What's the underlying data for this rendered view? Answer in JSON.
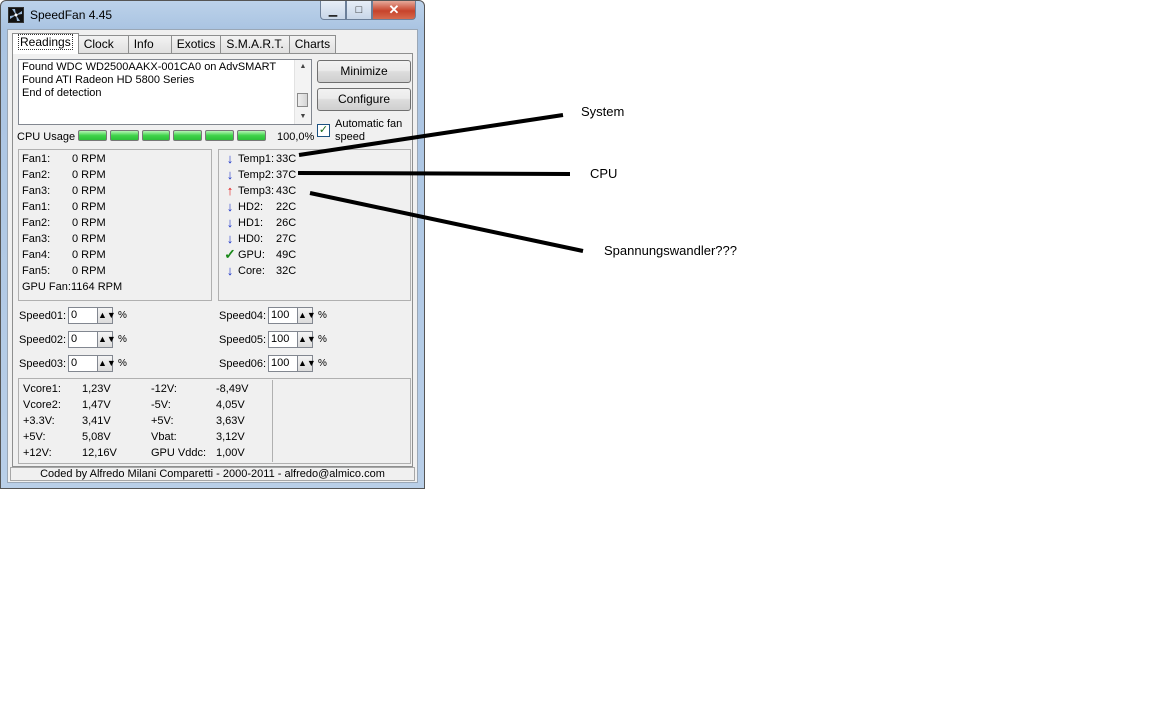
{
  "window": {
    "title": "SpeedFan 4.45",
    "caption": {
      "min": "▁",
      "max": "□",
      "close": "✕"
    }
  },
  "tabs": [
    {
      "label": "Readings",
      "active": true
    },
    {
      "label": "Clock"
    },
    {
      "label": "Info"
    },
    {
      "label": "Exotics"
    },
    {
      "label": "S.M.A.R.T."
    },
    {
      "label": "Charts"
    }
  ],
  "log": {
    "lines": [
      "Found WDC WD2500AAKX-001CA0 on AdvSMART",
      "Found ATI Radeon HD 5800 Series",
      "End of detection"
    ],
    "scroll_up": "▲",
    "scroll_down": "▼"
  },
  "buttons": {
    "minimize": "Minimize",
    "configure": "Configure"
  },
  "cpu": {
    "label": "CPU Usage",
    "percent": "100,0%",
    "fill": 1.0
  },
  "auto_fan": {
    "label": "Automatic fan speed",
    "checked": true,
    "mark": "✓"
  },
  "fans": [
    {
      "label": "Fan1:",
      "value": "0 RPM"
    },
    {
      "label": "Fan2:",
      "value": "0 RPM"
    },
    {
      "label": "Fan3:",
      "value": "0 RPM"
    },
    {
      "label": "Fan1:",
      "value": "0 RPM"
    },
    {
      "label": "Fan2:",
      "value": "0 RPM"
    },
    {
      "label": "Fan3:",
      "value": "0 RPM"
    },
    {
      "label": "Fan4:",
      "value": "0 RPM"
    },
    {
      "label": "Fan5:",
      "value": "0 RPM"
    },
    {
      "label": "GPU Fan:",
      "value": "1164 RPM"
    }
  ],
  "temps": [
    {
      "label": "Temp1:",
      "value": "33C",
      "trend": "↓",
      "status": "down"
    },
    {
      "label": "Temp2:",
      "value": "37C",
      "trend": "↓",
      "status": "down"
    },
    {
      "label": "Temp3:",
      "value": "43C",
      "trend": "↑",
      "status": "up"
    },
    {
      "label": "HD2:",
      "value": "22C",
      "trend": "↓",
      "status": "down"
    },
    {
      "label": "HD1:",
      "value": "26C",
      "trend": "↓",
      "status": "down"
    },
    {
      "label": "HD0:",
      "value": "27C",
      "trend": "↓",
      "status": "down"
    },
    {
      "label": "GPU:",
      "value": "49C",
      "trend": "✓",
      "status": "ok"
    },
    {
      "label": "Core:",
      "value": "32C",
      "trend": "↓",
      "status": "down"
    }
  ],
  "speeds_left": [
    {
      "label": "Speed01:",
      "value": "0"
    },
    {
      "label": "Speed02:",
      "value": "0"
    },
    {
      "label": "Speed03:",
      "value": "0"
    }
  ],
  "speeds_right": [
    {
      "label": "Speed04:",
      "value": "100"
    },
    {
      "label": "Speed05:",
      "value": "100"
    },
    {
      "label": "Speed06:",
      "value": "100"
    }
  ],
  "spin_glyph": "▲▼",
  "percent_sign": "%",
  "voltages_left": [
    {
      "label": "Vcore1:",
      "value": "1,23V"
    },
    {
      "label": "Vcore2:",
      "value": "1,47V"
    },
    {
      "label": "+3.3V:",
      "value": "3,41V"
    },
    {
      "label": "+5V:",
      "value": "5,08V"
    },
    {
      "label": "+12V:",
      "value": "12,16V"
    }
  ],
  "voltages_right": [
    {
      "label": "-12V:",
      "value": "-8,49V"
    },
    {
      "label": "-5V:",
      "value": "4,05V"
    },
    {
      "label": "+5V:",
      "value": "3,63V"
    },
    {
      "label": "Vbat:",
      "value": "3,12V"
    },
    {
      "label": "GPU Vddc:",
      "value": "1,00V"
    }
  ],
  "status_bar": "Coded by Alfredo Milani Comparetti - 2000-2011 - alfredo@almico.com",
  "annotations": {
    "system": "System",
    "cpu": "CPU",
    "vrm": "Spannungswandler???"
  },
  "colors": {
    "down_arrow": "#1630c8",
    "up_arrow": "#e01010",
    "ok_check": "#1b8a1b",
    "cpu_bar": "#3fd34a"
  }
}
